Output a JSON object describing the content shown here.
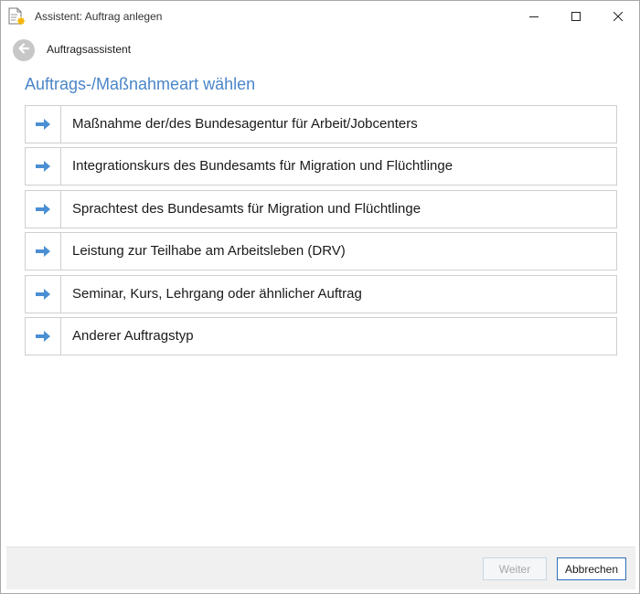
{
  "window": {
    "title": "Assistent: Auftrag anlegen",
    "icon": "document-wizard-icon"
  },
  "nav": {
    "back_icon": "back-arrow-icon",
    "title": "Auftragsassistent"
  },
  "heading": "Auftrags-/Maßnahmeart wählen",
  "options": [
    {
      "label": "Maßnahme der/des Bundesagentur für Arbeit/Jobcenters",
      "icon": "arrow-right-icon"
    },
    {
      "label": "Integrationskurs des Bundesamts für Migration und Flüchtlinge",
      "icon": "arrow-right-icon"
    },
    {
      "label": "Sprachtest des Bundesamts für Migration und Flüchtlinge",
      "icon": "arrow-right-icon"
    },
    {
      "label": "Leistung zur Teilhabe am Arbeitsleben (DRV)",
      "icon": "arrow-right-icon"
    },
    {
      "label": "Seminar, Kurs, Lehrgang oder ähnlicher Auftrag",
      "icon": "arrow-right-icon"
    },
    {
      "label": "Anderer Auftragstyp",
      "icon": "arrow-right-icon"
    }
  ],
  "footer": {
    "next_label": "Weiter",
    "next_enabled": false,
    "cancel_label": "Abbrechen"
  },
  "colors": {
    "accent": "#4a86c8",
    "arrow": "#4a8fd4",
    "primary_border": "#2d6fbe"
  }
}
